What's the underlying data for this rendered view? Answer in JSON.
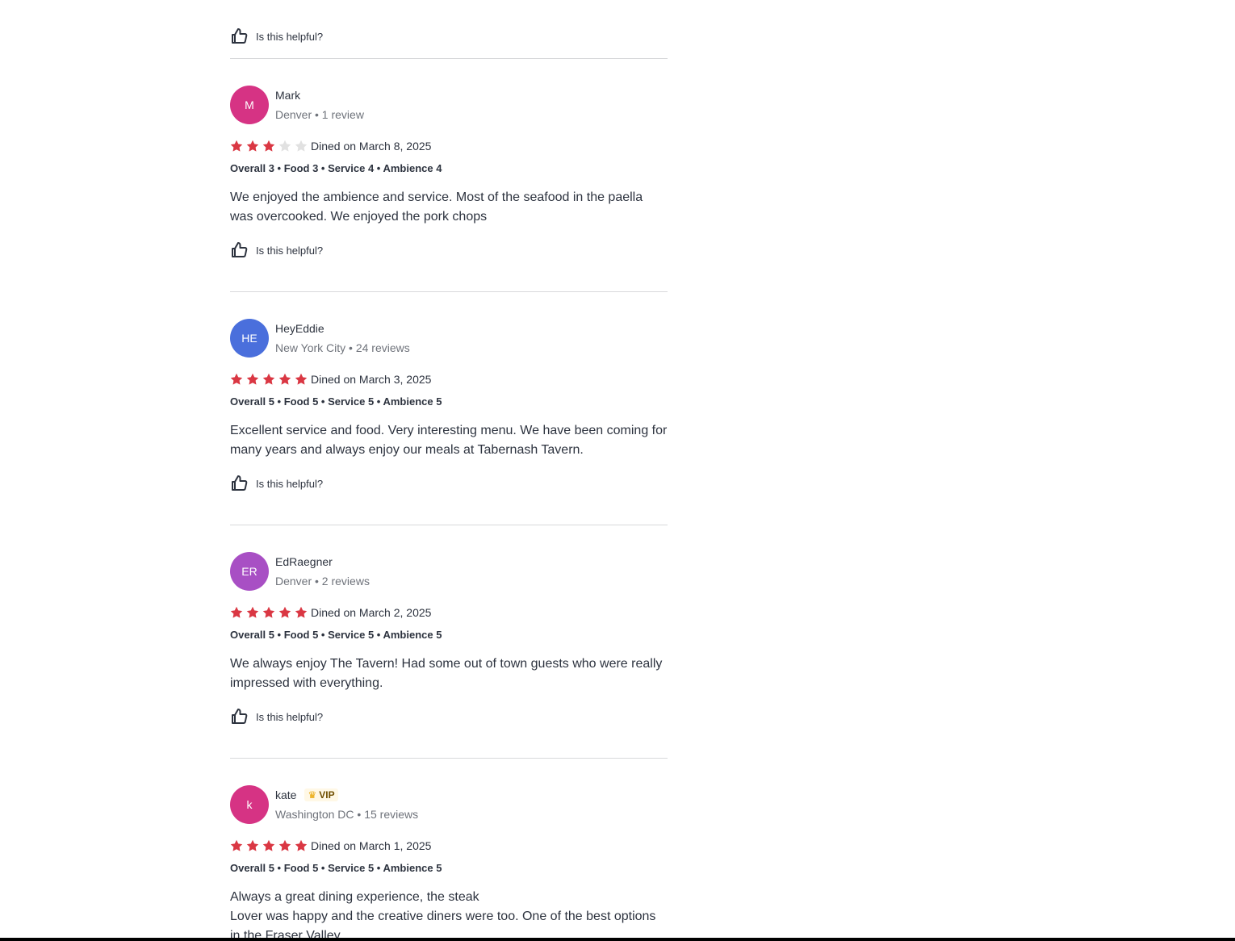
{
  "colors": {
    "star_filled": "#da3743",
    "star_empty": "#e1e1e1",
    "divider": "#d8d9db",
    "text_primary": "#2d333f",
    "text_secondary": "#6f737b"
  },
  "helpful_label": "Is this helpful?",
  "reviews": [
    {
      "initials": "M",
      "avatar_color": "#d63384",
      "name": "Mark",
      "vip": "",
      "meta": "Denver • 1 review",
      "stars": 3,
      "dined": "Dined on March 8, 2025",
      "ratings": "Overall 3 • Food 3 • Service 4 • Ambience 4",
      "text": "We enjoyed the ambience and service. Most of the seafood in the paella was overcooked. We enjoyed the pork chops",
      "helpful": "Is this helpful?"
    },
    {
      "initials": "HE",
      "avatar_color": "#4a6fdc",
      "name": "HeyEddie",
      "vip": "",
      "meta": "New York City • 24 reviews",
      "stars": 5,
      "dined": "Dined on March 3, 2025",
      "ratings": "Overall 5 • Food 5 • Service 5 • Ambience 5",
      "text": "Excellent service and food. Very interesting menu. We have been coming for many years and always enjoy our meals at Tabernash Tavern.",
      "helpful": "Is this helpful?"
    },
    {
      "initials": "ER",
      "avatar_color": "#a84fc4",
      "name": "EdRaegner",
      "vip": "",
      "meta": "Denver • 2 reviews",
      "stars": 5,
      "dined": "Dined on March 2, 2025",
      "ratings": "Overall 5 • Food 5 • Service 5 • Ambience 5",
      "text": "We always enjoy The Tavern! Had some out of town guests who were really impressed with everything.",
      "helpful": "Is this helpful?"
    },
    {
      "initials": "k",
      "avatar_color": "#d63384",
      "name": "kate",
      "vip": "VIP",
      "meta": "Washington DC • 15 reviews",
      "stars": 5,
      "dined": "Dined on March 1, 2025",
      "ratings": "Overall 5 • Food 5 • Service 5 • Ambience 5",
      "text": "Always a great dining experience,  the steak\nLover was happy and the creative diners were too.  One of the best options in the Fraser Valley",
      "helpful": ""
    }
  ]
}
